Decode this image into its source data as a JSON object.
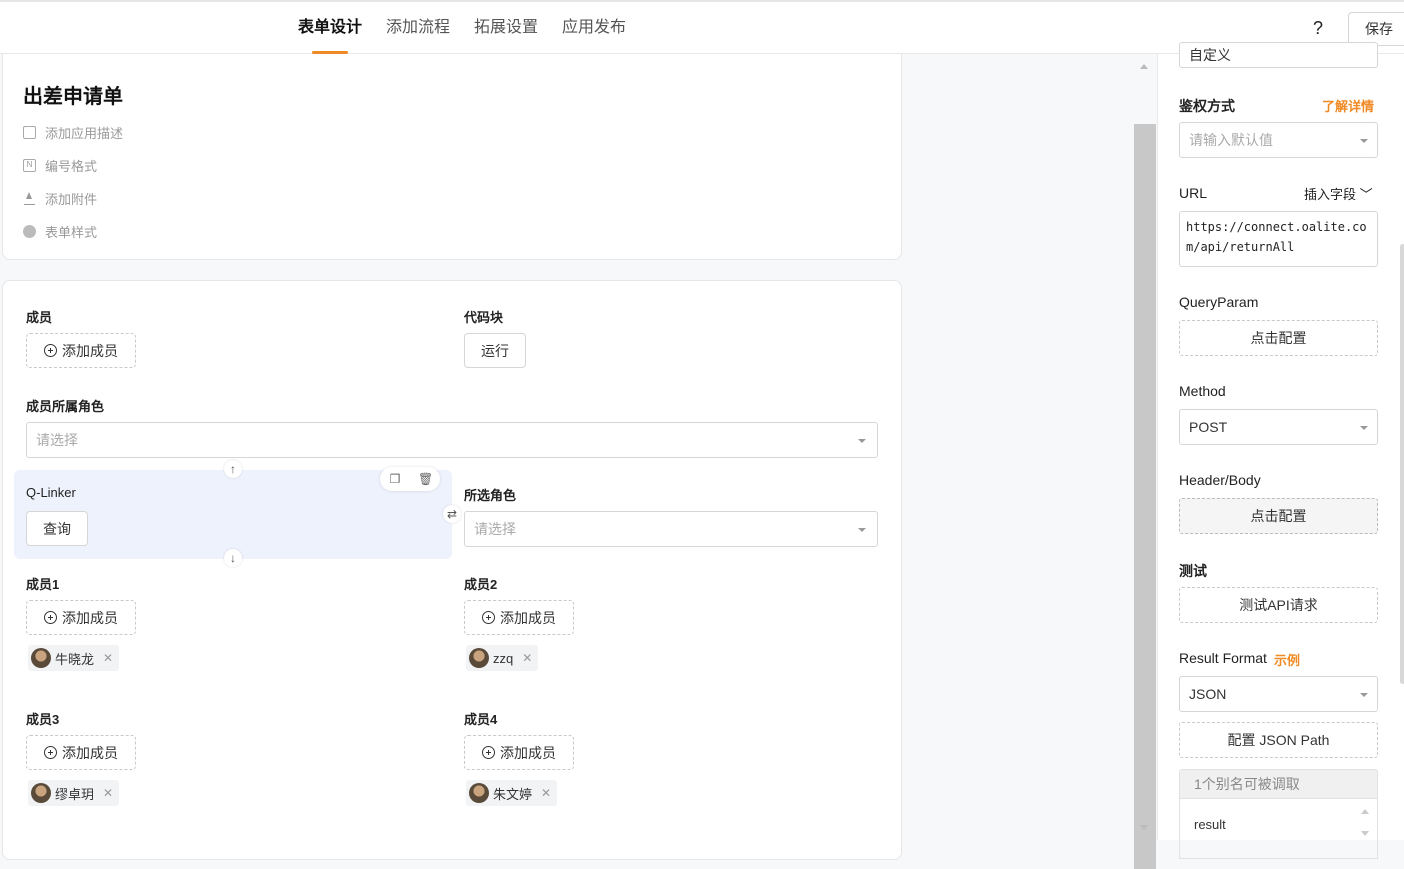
{
  "header": {
    "tabs": [
      {
        "label": "表单设计",
        "active": true
      },
      {
        "label": "添加流程",
        "active": false
      },
      {
        "label": "拓展设置",
        "active": false
      },
      {
        "label": "应用发布",
        "active": false
      }
    ],
    "help_label": "?",
    "save_label": "保存",
    "accent_color": "#f08a24"
  },
  "form_info": {
    "title": "出差申请单",
    "links": [
      {
        "label": "添加应用描述",
        "icon": "message-icon"
      },
      {
        "label": "编号格式",
        "icon": "number-icon"
      },
      {
        "label": "添加附件",
        "icon": "upload-icon"
      },
      {
        "label": "表单样式",
        "icon": "palette-icon"
      }
    ]
  },
  "fields": {
    "member": {
      "label": "成员",
      "button": "添加成员"
    },
    "code_block": {
      "label": "代码块",
      "button": "运行"
    },
    "member_role": {
      "label": "成员所属角色",
      "placeholder": "请选择"
    },
    "qlinker": {
      "label": "Q-Linker",
      "button": "查询"
    },
    "selected_role": {
      "label": "所选角色",
      "placeholder": "请选择"
    },
    "member1": {
      "label": "成员1",
      "button": "添加成员",
      "tag": "牛晓龙"
    },
    "member2": {
      "label": "成员2",
      "button": "添加成员",
      "tag": "zzq"
    },
    "member3": {
      "label": "成员3",
      "button": "添加成员",
      "tag": "缪卓玥"
    },
    "member4": {
      "label": "成员4",
      "button": "添加成员",
      "tag": "朱文婷"
    }
  },
  "panel": {
    "top_cut_value": "自定义",
    "auth": {
      "label": "鉴权方式",
      "link": "了解详情",
      "placeholder": "请输入默认值"
    },
    "url": {
      "label": "URL",
      "insert": "插入字段",
      "value": "https://connect.oalite.com/api/returnAll"
    },
    "query_param": {
      "label": "QueryParam",
      "button": "点击配置"
    },
    "method": {
      "label": "Method",
      "value": "POST"
    },
    "header_body": {
      "label": "Header/Body",
      "button": "点击配置"
    },
    "test": {
      "label": "测试",
      "button": "测试API请求"
    },
    "result_format": {
      "label": "Result Format",
      "link": "示例",
      "value": "JSON",
      "json_path_button": "配置 JSON Path"
    },
    "alias": {
      "header": "1个别名可被调取",
      "item": "result"
    }
  }
}
